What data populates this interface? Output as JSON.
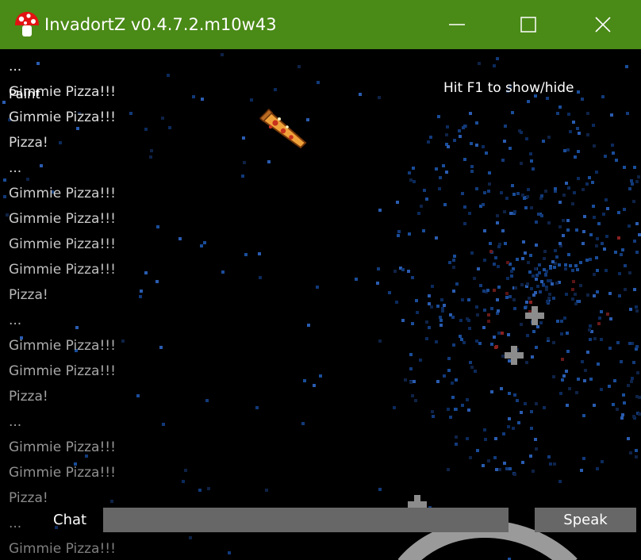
{
  "window": {
    "title": "InvadortZ v0.4.7.2.m10w43",
    "icon": "mushroom-icon",
    "titlebar_color": "#4a8a17",
    "controls": [
      "minimize-icon",
      "maximize-icon",
      "close-icon"
    ]
  },
  "overlay": {
    "help_text": "Hit F1 to show/hide",
    "paint_label": "Paint"
  },
  "chat_log": [
    {
      "text": "...",
      "color": "#e8e8e8"
    },
    {
      "text": "Gimmie Pizza!!!",
      "color": "#e3e3e3"
    },
    {
      "text": "Gimmie Pizza!!!",
      "color": "#dedede"
    },
    {
      "text": "Pizza!",
      "color": "#d9d9d9"
    },
    {
      "text": "...",
      "color": "#d4d4d4"
    },
    {
      "text": "Gimmie Pizza!!!",
      "color": "#cfcfcf"
    },
    {
      "text": "Gimmie Pizza!!!",
      "color": "#cacaca"
    },
    {
      "text": "Gimmie Pizza!!!",
      "color": "#c4c4c4"
    },
    {
      "text": "Gimmie Pizza!!!",
      "color": "#bfbfbf"
    },
    {
      "text": "Pizza!",
      "color": "#bababa"
    },
    {
      "text": "...",
      "color": "#b4b4b4"
    },
    {
      "text": "Gimmie Pizza!!!",
      "color": "#aeaeae"
    },
    {
      "text": "Gimmie Pizza!!!",
      "color": "#a8a8a8"
    },
    {
      "text": "Pizza!",
      "color": "#a2a2a2"
    },
    {
      "text": "...",
      "color": "#9c9c9c"
    },
    {
      "text": "Gimmie Pizza!!!",
      "color": "#969696"
    },
    {
      "text": "Gimmie Pizza!!!",
      "color": "#909090"
    },
    {
      "text": "Pizza!",
      "color": "#8a8a8a"
    },
    {
      "text": "...",
      "color": "#848484"
    },
    {
      "text": "Gimmie Pizza!!!",
      "color": "#7e7e7e"
    }
  ],
  "sprites": {
    "pizza": "pizza-slice-icon"
  },
  "chat_bar": {
    "label": "Chat",
    "input_value": "",
    "button_label": "Speak",
    "bar_color": "#676767"
  }
}
